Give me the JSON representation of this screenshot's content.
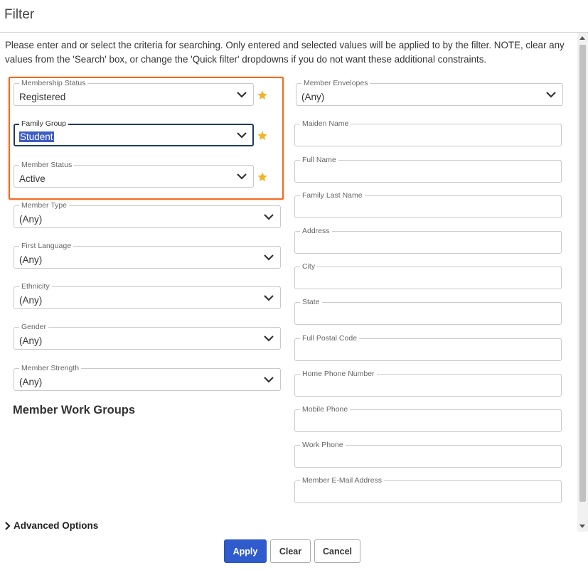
{
  "dialog": {
    "title": "Filter",
    "intro": "Please enter and or select the criteria for searching. Only entered and selected values will be applied to by the filter. NOTE, clear any values from the 'Search' box, or change the 'Quick filter' dropdowns if you do not want these additional constraints."
  },
  "left_fields": [
    {
      "label": "Membership Status",
      "value": "Registered",
      "starred": true
    },
    {
      "label": "Family Group",
      "value": "Student",
      "starred": true,
      "focused": true
    },
    {
      "label": "Member Status",
      "value": "Active",
      "starred": true
    },
    {
      "label": "Member Type",
      "value": "(Any)"
    },
    {
      "label": "First Language",
      "value": "(Any)"
    },
    {
      "label": "Ethnicity",
      "value": "(Any)"
    },
    {
      "label": "Gender",
      "value": "(Any)"
    },
    {
      "label": "Member Strength",
      "value": "(Any)"
    }
  ],
  "work_groups_title": "Member Work Groups",
  "right_fields": [
    {
      "label": "Member Envelopes",
      "value": "(Any)",
      "type": "select"
    },
    {
      "label": "Maiden Name",
      "value": "",
      "type": "text"
    },
    {
      "label": "Full Name",
      "value": "",
      "type": "text"
    },
    {
      "label": "Family Last Name",
      "value": "",
      "type": "text"
    },
    {
      "label": "Address",
      "value": "",
      "type": "text"
    },
    {
      "label": "City",
      "value": "",
      "type": "text"
    },
    {
      "label": "State",
      "value": "",
      "type": "text"
    },
    {
      "label": "Full Postal Code",
      "value": "",
      "type": "text"
    },
    {
      "label": "Home Phone Number",
      "value": "",
      "type": "text"
    },
    {
      "label": "Mobile Phone",
      "value": "",
      "type": "text"
    },
    {
      "label": "Work Phone",
      "value": "",
      "type": "text"
    },
    {
      "label": "Member E-Mail Address",
      "value": "",
      "type": "text"
    }
  ],
  "advanced_options_label": "Advanced Options",
  "buttons": {
    "apply": "Apply",
    "clear": "Clear",
    "cancel": "Cancel"
  },
  "colors": {
    "accent": "#2f5bcc",
    "highlight": "#f26b21",
    "star": "#f0b429",
    "focus": "#1f3a66"
  }
}
